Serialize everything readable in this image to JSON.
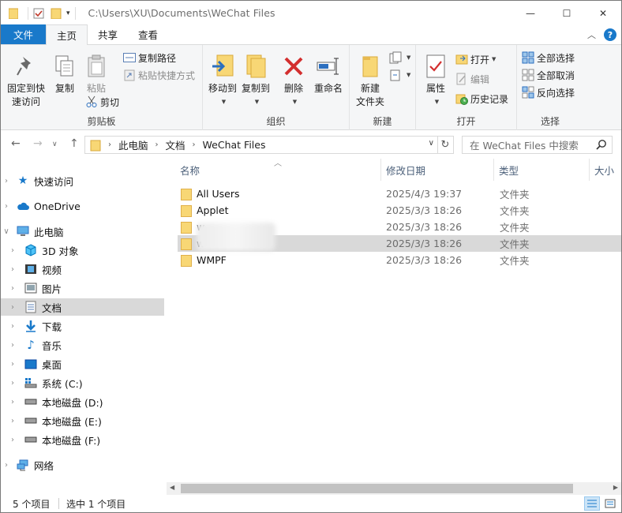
{
  "titlebar": {
    "path": "C:\\Users\\XU\\Documents\\WeChat Files",
    "minimize": "—",
    "maximize": "☐",
    "close": "✕"
  },
  "tabs": {
    "file": "文件",
    "home": "主页",
    "share": "共享",
    "view": "查看",
    "help": "?"
  },
  "ribbon": {
    "clipboard": {
      "label": "剪贴板",
      "pin_line1": "固定到快",
      "pin_line2": "速访问",
      "copy": "复制",
      "paste": "粘贴",
      "copy_path": "复制路径",
      "paste_shortcut": "粘贴快捷方式",
      "cut": "剪切"
    },
    "organize": {
      "label": "组织",
      "move_to": "移动到",
      "copy_to": "复制到",
      "delete": "删除",
      "rename": "重命名"
    },
    "new": {
      "label": "新建",
      "new_folder_line1": "新建",
      "new_folder_line2": "文件夹"
    },
    "open": {
      "label": "打开",
      "properties": "属性",
      "open": "打开",
      "edit": "编辑",
      "history": "历史记录"
    },
    "select": {
      "label": "选择",
      "select_all": "全部选择",
      "select_none": "全部取消",
      "invert": "反向选择"
    }
  },
  "address": {
    "crumbs": [
      "此电脑",
      "文档",
      "WeChat Files"
    ],
    "search_placeholder": "在 WeChat Files 中搜索"
  },
  "nav": {
    "quick_access": "快速访问",
    "onedrive": "OneDrive",
    "this_pc": "此电脑",
    "objects3d": "3D 对象",
    "videos": "视频",
    "pictures": "图片",
    "documents": "文档",
    "downloads": "下载",
    "music": "音乐",
    "desktop": "桌面",
    "drive_c": "系统 (C:)",
    "drive_d": "本地磁盘 (D:)",
    "drive_e": "本地磁盘 (E:)",
    "drive_f": "本地磁盘 (F:)",
    "network": "网络"
  },
  "columns": {
    "name": "名称",
    "modified": "修改日期",
    "type": "类型",
    "size": "大小"
  },
  "files": [
    {
      "name": "All Users",
      "modified": "2025/4/3 19:37",
      "type": "文件夹"
    },
    {
      "name": "Applet",
      "modified": "2025/3/3 18:26",
      "type": "文件夹"
    },
    {
      "name": "w",
      "modified": "2025/3/3 18:26",
      "type": "文件夹"
    },
    {
      "name": "w",
      "modified": "2025/3/3 18:26",
      "type": "文件夹"
    },
    {
      "name": "WMPF",
      "modified": "2025/3/3 18:26",
      "type": "文件夹"
    }
  ],
  "status": {
    "count": "5 个项目",
    "selected": "选中 1 个项目"
  },
  "colors": {
    "accent": "#1979ca",
    "selection": "#d9d9d9",
    "folder": "#f8d775"
  }
}
